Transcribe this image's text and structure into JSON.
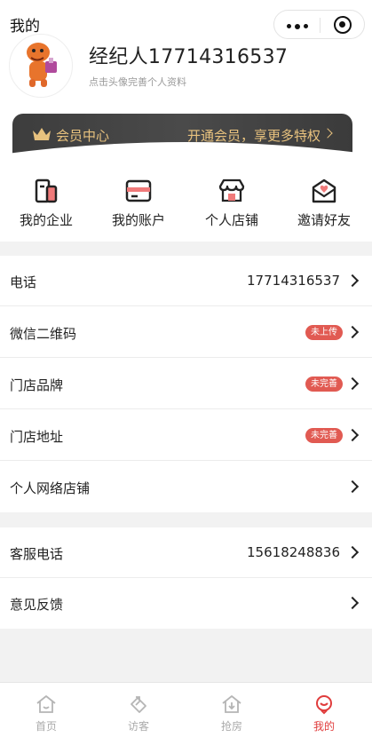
{
  "header": {
    "title": "我的"
  },
  "profile": {
    "name": "经纪人17714316537",
    "hint": "点击头像完善个人资料"
  },
  "vip": {
    "label": "会员中心",
    "promo": "开通会员，享更多特权",
    "accent": "#e8c27e"
  },
  "quick_actions": [
    {
      "label": "我的企业",
      "icon": "company-icon"
    },
    {
      "label": "我的账户",
      "icon": "account-card-icon"
    },
    {
      "label": "个人店铺",
      "icon": "shop-icon"
    },
    {
      "label": "邀请好友",
      "icon": "invite-envelope-icon"
    }
  ],
  "info_rows": [
    {
      "label": "电话",
      "value": "17714316537"
    },
    {
      "label": "微信二维码",
      "badge": "未上传"
    },
    {
      "label": "门店品牌",
      "badge": "未完善"
    },
    {
      "label": "门店地址",
      "badge": "未完善"
    },
    {
      "label": "个人网络店铺"
    }
  ],
  "service_rows": [
    {
      "label": "客服电话",
      "value": "15618248836"
    },
    {
      "label": "意见反馈"
    }
  ],
  "tabbar": {
    "items": [
      {
        "label": "首页",
        "icon": "home-icon"
      },
      {
        "label": "访客",
        "icon": "visitor-icon"
      },
      {
        "label": "抢房",
        "icon": "grab-house-icon"
      },
      {
        "label": "我的",
        "icon": "profile-icon",
        "active": true
      }
    ],
    "active_color": "#e03c3c",
    "inactive_color": "#aaaaaa"
  },
  "colors": {
    "badge": "#e15a52",
    "background": "#f2f2f2"
  }
}
